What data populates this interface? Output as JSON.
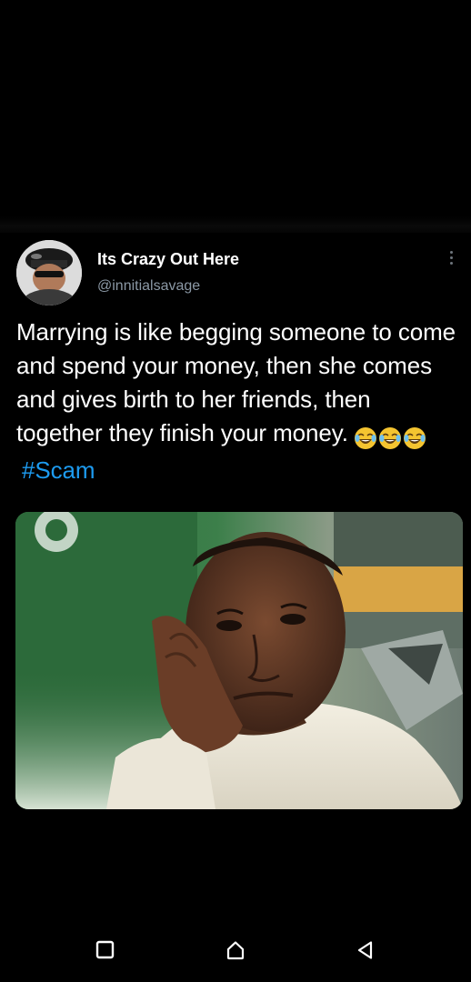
{
  "tweet": {
    "display_name": "Its Crazy Out Here",
    "handle": "@innitialsavage",
    "text": "Marrying is like begging someone to come and spend your money, then she comes and gives birth to her friends, then together they finish your money.",
    "emojis": [
      "tears-of-joy",
      "tears-of-joy",
      "tears-of-joy"
    ],
    "hashtag": "#Scam",
    "more_icon": "more-vertical"
  },
  "media": {
    "description_icon": "photo"
  },
  "nav_bar": {
    "recents_icon": "square",
    "home_icon": "home",
    "back_icon": "triangle-back"
  },
  "colors": {
    "background": "#000000",
    "text": "#ffffff",
    "handle": "#8b98a5",
    "hashtag": "#1d9bf0"
  }
}
